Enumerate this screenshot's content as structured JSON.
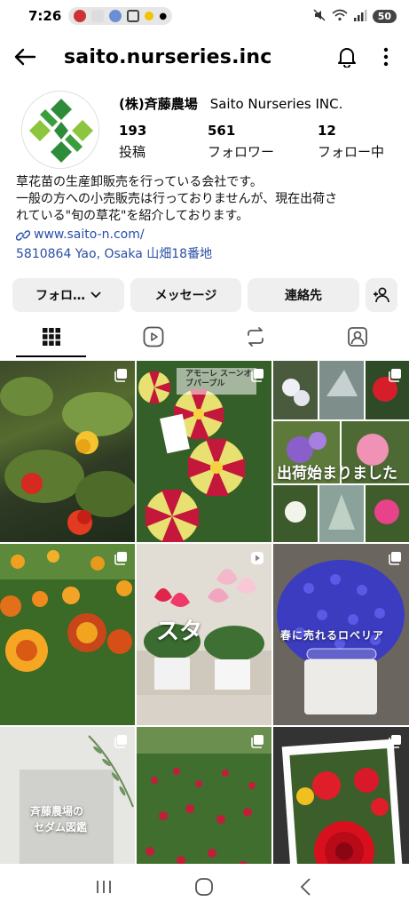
{
  "status_bar": {
    "time": "7:26",
    "battery": "50"
  },
  "header": {
    "username": "saito.nurseries.inc"
  },
  "profile": {
    "display_name": "(株)斉藤農場",
    "display_name_en": "Saito Nurseries INC.",
    "stats": [
      {
        "value": "193",
        "label": "投稿"
      },
      {
        "value": "561",
        "label": "フォロワー"
      },
      {
        "value": "12",
        "label": "フォロー中"
      }
    ]
  },
  "bio": {
    "lines": [
      "草花苗の生産卸販売を行っている会社です。",
      "一般の方への小売販売は行っておりませんが、現在出荷さ",
      "れている\"旬の草花\"を紹介しております。"
    ],
    "link": "www.saito-n.com/",
    "address": "5810864 Yao, Osaka 山畑18番地"
  },
  "actions": {
    "follow": "フォロ…",
    "message": "メッセージ",
    "contact": "連絡先"
  },
  "tabs": [
    "grid-tab",
    "reels-tab",
    "reposts-tab",
    "tagged-tab"
  ],
  "grid": {
    "tile2_text": "アモーレ スーンオブパープル",
    "tile3_text": "出荷始まりました",
    "tile5_text": "スタ",
    "tile6_text": "春に売れるロベリア",
    "tile7_text_1": "斉藤農場の",
    "tile7_text_2": "セダム図鑑"
  },
  "colors": {
    "link": "#2a4fa8",
    "button_bg": "#efefef",
    "accent_green": "#3a9e3c"
  }
}
